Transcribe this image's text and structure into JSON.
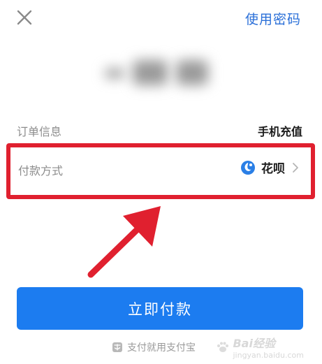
{
  "header": {
    "close_icon": "close-icon",
    "use_password_label": "使用密码"
  },
  "amount": {
    "display": "blurred"
  },
  "order": {
    "label": "订单信息",
    "value": "手机充值"
  },
  "payment": {
    "label": "付款方式",
    "method": "花呗",
    "method_icon": "huabei-icon",
    "chevron_icon": "chevron-right-icon"
  },
  "actions": {
    "pay_button_label": "立即付款"
  },
  "footer": {
    "text": "支付就用支付宝",
    "icon": "shield-icon"
  },
  "watermark": {
    "text": "Bai经验",
    "sub": "jingyan.baidu.com"
  },
  "colors": {
    "accent": "#1c7cf0",
    "link": "#2a6fd8",
    "highlight": "#e0202f"
  }
}
